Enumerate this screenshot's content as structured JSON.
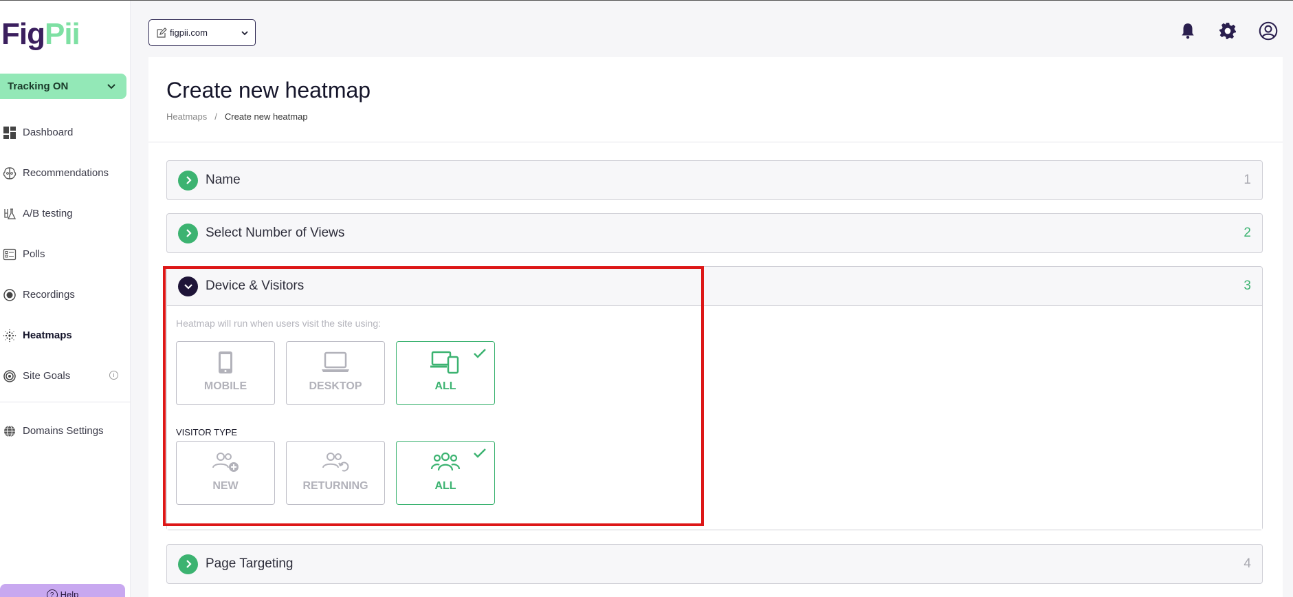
{
  "app": {
    "logo_part1": "Fig",
    "logo_part2": "Pii"
  },
  "sidebar": {
    "tracking_label": "Tracking ON",
    "items": [
      {
        "label": "Dashboard",
        "icon": "dashboard-icon"
      },
      {
        "label": "Recommendations",
        "icon": "brain-icon"
      },
      {
        "label": "A/B testing",
        "icon": "flask-icon"
      },
      {
        "label": "Polls",
        "icon": "poll-icon"
      },
      {
        "label": "Recordings",
        "icon": "record-icon"
      },
      {
        "label": "Heatmaps",
        "icon": "heatmap-icon"
      },
      {
        "label": "Site Goals",
        "icon": "target-icon"
      }
    ],
    "domains_label": "Domains Settings",
    "help_label": "Help"
  },
  "topbar": {
    "domain": "figpii.com"
  },
  "page": {
    "title": "Create new heatmap",
    "breadcrumb_root": "Heatmaps",
    "breadcrumb_sep": "/",
    "breadcrumb_current": "Create new heatmap"
  },
  "sections": {
    "name": {
      "title": "Name",
      "num": "1"
    },
    "views": {
      "title": "Select Number of Views",
      "num": "2"
    },
    "device": {
      "title": "Device & Visitors",
      "num": "3"
    },
    "targeting": {
      "title": "Page Targeting",
      "num": "4"
    }
  },
  "device": {
    "hint": "Heatmap will run when users visit the site using:",
    "options": [
      {
        "label": "MOBILE",
        "selected": false
      },
      {
        "label": "DESKTOP",
        "selected": false
      },
      {
        "label": "ALL",
        "selected": true
      }
    ],
    "visitor_type_label": "VISITOR TYPE",
    "visitor_options": [
      {
        "label": "NEW",
        "selected": false
      },
      {
        "label": "RETURNING",
        "selected": false
      },
      {
        "label": "ALL",
        "selected": true
      }
    ]
  },
  "colors": {
    "accent_green": "#3cb371",
    "brand_dark": "#1e1438",
    "highlight": "#dd1717"
  }
}
